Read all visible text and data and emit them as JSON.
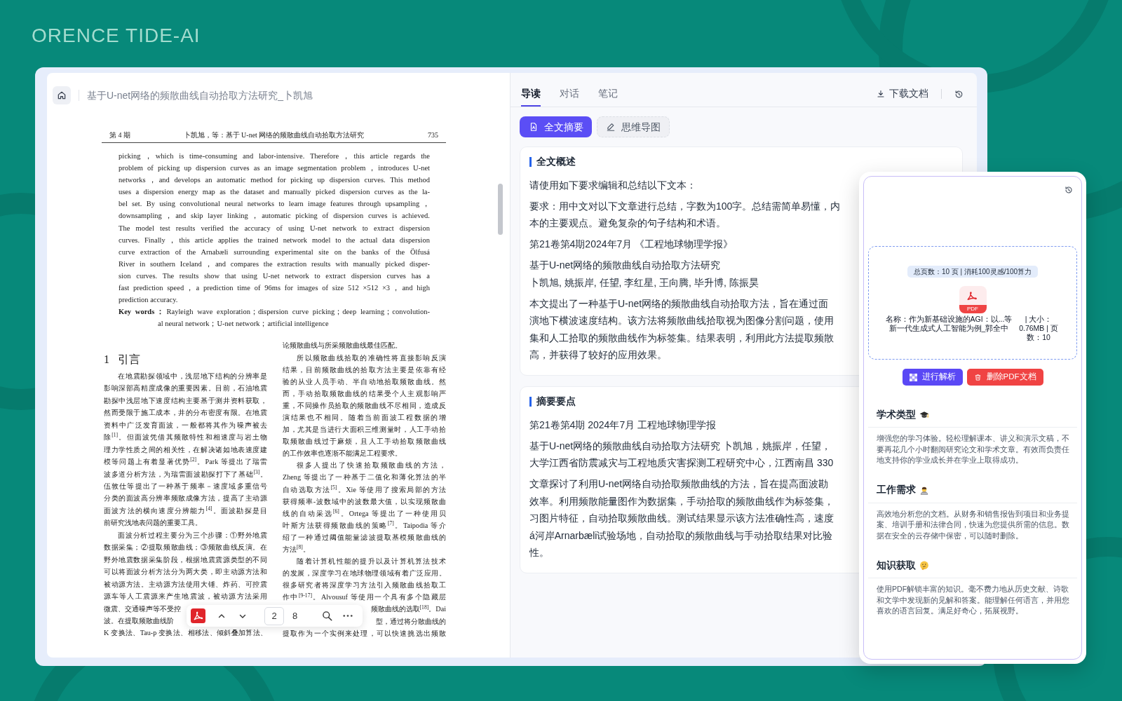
{
  "brand": {
    "name": "ORENCE TIDE-AI"
  },
  "viewer": {
    "title": "基于U-net网络的频散曲线自动拾取方法研究_卜凯旭",
    "page": {
      "header": {
        "issue": "第 4 期",
        "title": "卜凯旭，等：基于 U-net 网络的频散曲线自动拾取方法研究",
        "number": "735"
      },
      "abstract": {
        "lines": [
          "picking，which is time-consuming and labor-intensive. Therefore，this article regards the",
          "problem of picking up dispersion curves as an image segmentation problem，introduces U-net",
          "networks，and develops an automatic method for picking up dispersion curves. This method",
          "uses a dispersion energy map as the dataset and manually picked dispersion curves as the la-",
          "bel set. By using convolutional neural networks to learn image features through upsampling，",
          "downsampling，and skip layer linking，automatic picking of dispersion curves is achieved.",
          "The model test results verified the accuracy of using U-net network to extract dispersion",
          "curves. Finally，this article applies the trained network model to the actual data dispersion",
          "curve extraction of the Arnabæli surrounding experimental site on the banks of the Ölfusá",
          "River in southern Iceland，and compares the extraction results with manually picked disper-",
          "sion curves. The results show that using U-net network to extract dispersion curves has a",
          "fast prediction speed，a prediction time of 96ms for images of size 512 ×512 ×3，and high",
          "prediction accuracy."
        ]
      },
      "keywords": {
        "label": "Key words：",
        "lines": [
          "Rayleigh wave exploration；dispersion curve picking；deep learning；convolution-",
          "al neural network；U-net network；artificial intelligence"
        ]
      },
      "columns": [
        {
          "blocks": [
            {
              "kind": "heading",
              "number": "1",
              "title": "引言"
            },
            {
              "kind": "para",
              "indent": true,
              "ends": true,
              "lines": [
                "在地震勘探领域中，浅层地下结构的分辨率是",
                "影响深部高精度成像的重要因素。目前，石油地震",
                "勘探中浅层地下速度结构主要基于测井资料获取，",
                "然而受限于施工成本，井的分布密度有限。在地震",
                "资料中广泛发育面波，一般都将其作为噪声被去",
                "除$^{[1]}$。但面波凭借其频散特性和相速度与岩土物",
                "理力学性质之间的相关性，在解决诸如地表速度建",
                "模等问题上有着显著优势$^{[2]}$。Park 等提出了瑞雷",
                "波多道分析方法，为瑞雷面波勘探打下了基础$^{[3]}$。",
                "伍敦仕等提出了一种基于频率－速度域多重信号",
                "分类的面波高分辨率频散成像方法，提高了主动源",
                "面波方法的横向速度分辨能力$^{[4]}$。面波勘探是目",
                "前研究浅地表问题的重要工具。"
              ]
            },
            {
              "kind": "para",
              "indent": true,
              "ends": false,
              "lines": [
                "面波分析过程主要分为三个步骤：①野外地震",
                "数据采集；②提取频散曲线；③频散曲线反演。在",
                "野外地震数据采集阶段，根据地震震源类型的不同",
                "可以将面波分析方法分为两大类，即主动源方法和",
                "被动源方法。主动源方法使用大锤、炸药、可控震",
                "源车等人工震源来产生地震波，被动源方法采用"
              ]
            },
            {
              "kind": "head",
              "text": "微震、交通噪声等不受控"
            },
            {
              "kind": "head",
              "text": "波。在提取频散曲线阶"
            },
            {
              "kind": "para",
              "indent": false,
              "ends": false,
              "lines": [
                "K 变换法、Tau-p 变换法、相移法、倾斜叠加算法、"
              ]
            }
          ]
        },
        {
          "blocks": [
            {
              "kind": "para",
              "indent": false,
              "ends": true,
              "lines": [
                "论频散曲线与所采频散曲线最佳匹配。"
              ]
            },
            {
              "kind": "para",
              "indent": true,
              "ends": true,
              "lines": [
                "所以频散曲线拾取的准确性将直接影响反演",
                "结果，目前频散曲线的拾取方法主要是依靠有经",
                "验的从业人员手动、半自动地拾取频散曲线。然",
                "而，手动拾取频散曲线的结果受个人主观影响严",
                "重，不同操作员拾取的频散曲线不尽相同，造成反",
                "演结果也不相同。随着当前面波工程数据的增",
                "加，尤其是当进行大面积三维测量时，人工手动拾",
                "取频散曲线过于麻烦，且人工手动拾取频散曲线",
                "的工作效率也逐渐不能满足工程要求。"
              ]
            },
            {
              "kind": "para",
              "indent": true,
              "ends": true,
              "lines": [
                "很多人提出了快速拾取频散曲线的方法，",
                "Zheng 等提出了一种基于二值化和薄化算法的半",
                "自动选取方法$^{[5]}$。Xie 等使用了搜索局部的方法",
                "获得频率-波数域中的波数最大值，以实现频散曲",
                "线的自动采选$^{[6]}$。Ortega 等提出了一种使用贝",
                "叶斯方法获得频散曲线的策略$^{[7]}$。Taipodia 等介",
                "绍了一种通过阈值能量滤波提取基模频散曲线的",
                "方法$^{[8]}$。"
              ]
            },
            {
              "kind": "para",
              "indent": true,
              "ends": false,
              "lines": [
                "随着计算机性能的提升以及计算机算法技术",
                "的发展，深度学习在地球物理领域有着广泛应用。",
                "很多研究者将深度学习方法引入频散曲线拾取工",
                "作中$^{[9-17]}$。Alvousuf 等使用一个具有多个隐藏层"
              ]
            },
            {
              "kind": "tail",
              "text": "频散曲线的选取$^{[18]}$。Dai"
            },
            {
              "kind": "tail",
              "text": "型，通过将分散曲线的"
            },
            {
              "kind": "para",
              "indent": false,
              "ends": false,
              "lines": [
                "提取作为一个实例来处理，可以快速挑选出频散"
              ]
            }
          ]
        }
      ]
    },
    "toolbar": {
      "page": "2",
      "page_count": "8"
    }
  },
  "assistant": {
    "tabs": [
      {
        "label": "导读",
        "selected": true
      },
      {
        "label": "对话",
        "selected": false
      },
      {
        "label": "笔记",
        "selected": false
      }
    ],
    "download": "下载文档",
    "modes": [
      {
        "label": "全文摘要",
        "selected": true
      },
      {
        "label": "思维导图",
        "selected": false
      }
    ],
    "cards": [
      {
        "title": "全文概述",
        "paragraphs": [
          {
            "lines": [
              "请使用如下要求编辑和总结以下文本："
            ]
          },
          {
            "lines": [
              "要求：用中文对以下文章进行总结，字数为100字。总结需简单易懂，内",
              "本的主要观点。避免复杂的句子结构和术语。"
            ]
          },
          {
            "lines": [
              "第21卷第4期2024年7月 《工程地球物理学报》"
            ]
          },
          {
            "lines": [
              "基于U-net网络的频散曲线自动拾取方法研究",
              "卜凯旭, 姚振岸, 任望, 李红星, 王向腾, 毕升博, 陈振昊"
            ]
          },
          {
            "lines": [
              "本文提出了一种基于U-net网络的频散曲线自动拾取方法，旨在通过面",
              "演地下横波速度结构。该方法将频散曲线拾取视为图像分割问题，使用",
              "集和人工拾取的频散曲线作为标签集。结果表明，利用此方法提取频散",
              "高，并获得了较好的应用效果。"
            ]
          }
        ]
      },
      {
        "title": "摘要要点",
        "paragraphs": [
          {
            "lines": [
              "第21卷第4期 2024年7月 工程地球物理学报"
            ]
          },
          {
            "lines": [
              "基于U-net网络的频散曲线自动拾取方法研究 卜凯旭，姚振岸，任望，",
              "大学江西省防震减灾与工程地质灾害探测工程研究中心，江西南昌 330"
            ]
          },
          {
            "lines": [
              "文章探讨了利用U-net网络自动拾取频散曲线的方法，旨在提高面波勘",
              "效率。利用频散能量图作为数据集，手动拾取的频散曲线作为标签集，",
              "习图片特征，自动拾取频散曲线。测试结果显示该方法准确性高，速度",
              "á河岸Arnarbæli试验场地，自动拾取的频散曲线与手动拾取结果对比验",
              "性。"
            ]
          }
        ]
      }
    ]
  },
  "dialog": {
    "badge": "总页数：10 页 | 消耗100灵感/100算力",
    "file": {
      "type": "PDF",
      "name": "名称：作为新基础设施的AGI：以...等新一代生成式人工智能为例_郭全中",
      "meta": "| 大小：0.76MB | 页数：10"
    },
    "buttons": [
      {
        "kind": "primary",
        "label": "进行解析"
      },
      {
        "kind": "danger",
        "label": "删除PDF文档"
      }
    ],
    "features": [
      {
        "title": "学术类型",
        "text": "增强您的学习体验。轻松理解课本、讲义和演示文稿，不要再花几个小时翻阅研究论文和学术文章。有效而负责任地支持你的学业成长并在学业上取得成功。"
      },
      {
        "title": "工作需求",
        "text": "高效地分析您的文档。从财务和销售报告到项目和业务提案、培训手册和法律合同，快速为您提供所需的信息。数据在安全的云存储中保密，可以随时删除。"
      },
      {
        "title": "知识获取",
        "text": "使用PDF解锁丰富的知识。毫不费力地从历史文献、诗歌和文学中发现新的见解和答案。能理解任何语言，并用您喜欢的语言回复。满足好奇心，拓展视野。"
      }
    ]
  }
}
